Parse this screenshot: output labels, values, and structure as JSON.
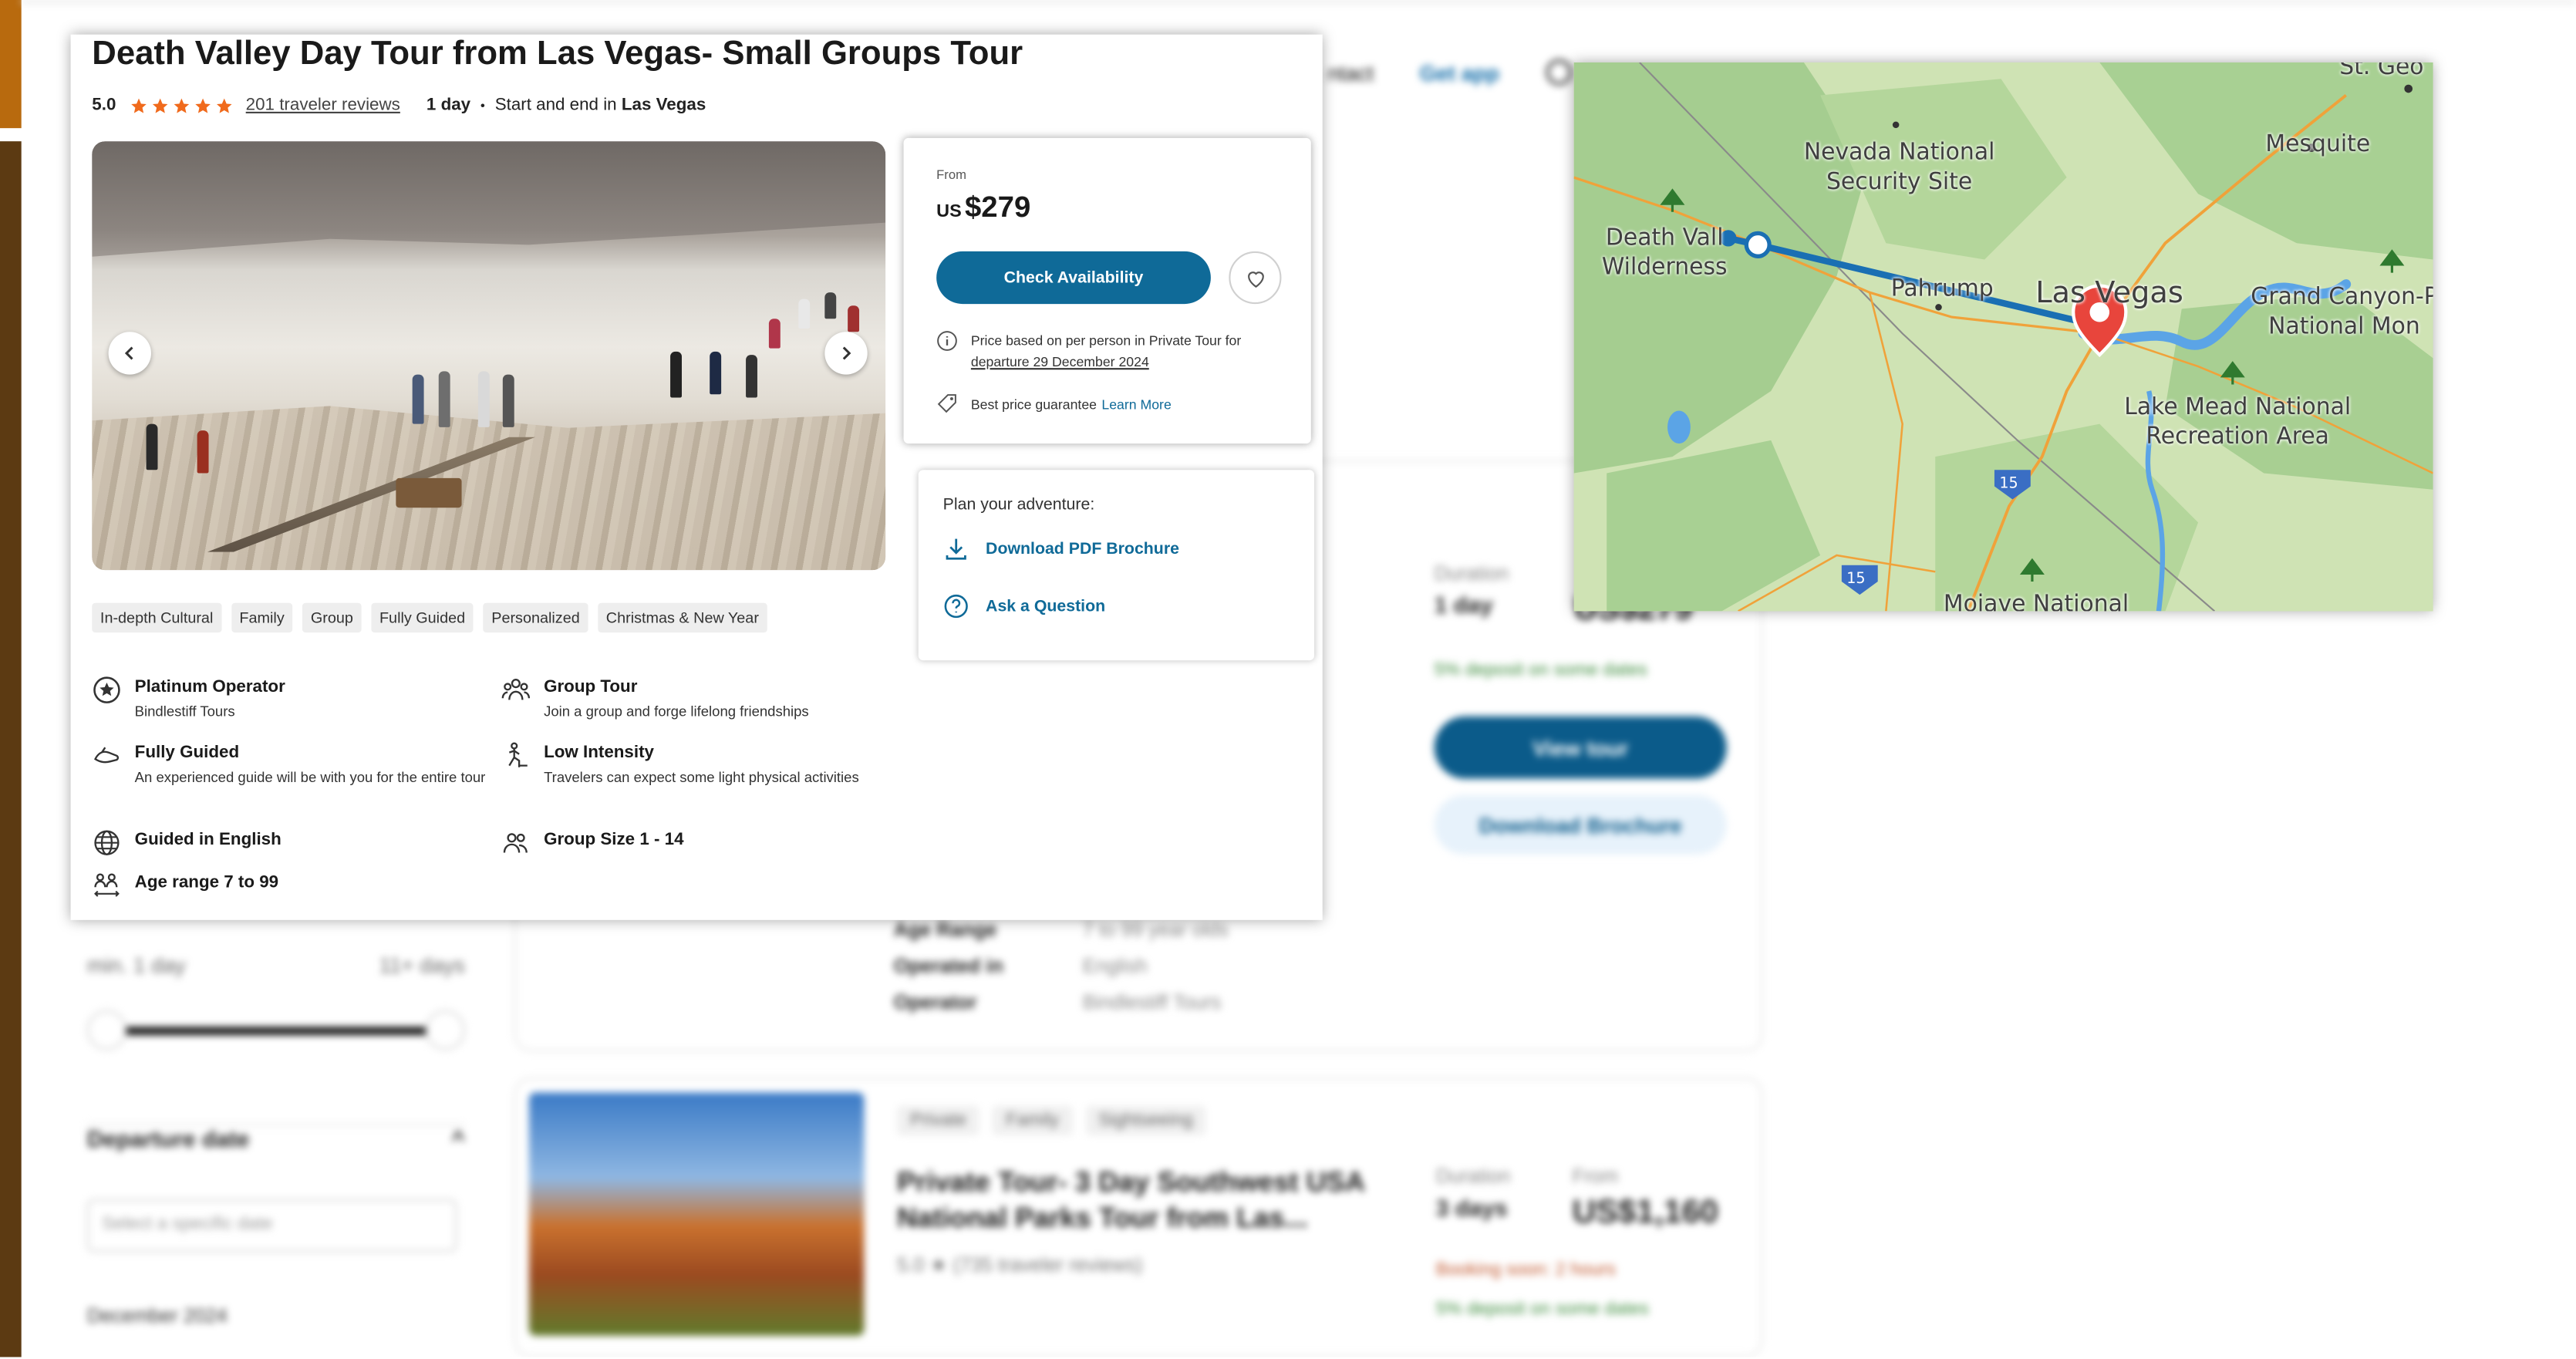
{
  "background": {
    "nav": {
      "contact": "ntact",
      "get_app": "Get app"
    },
    "card_labels": {
      "age_range": "Age Range",
      "operated_in": "Operated in",
      "operator": "Operator",
      "age_value": "7 to 99 year olds",
      "operated_value": "English",
      "operator_value": "Bindlestiff Tours"
    },
    "duration_label": "Duration",
    "duration_value": "1 day",
    "price_value": "US$279",
    "deposit_text": "5% deposit on some dates",
    "view_tour": "View tour",
    "download_brochure": "Download Brochure",
    "filter": {
      "min_label": "min. 1 day",
      "max_label": "11+ days",
      "departure_label": "Departure date",
      "date_placeholder": "Select a specific date",
      "month": "December 2024"
    },
    "card2": {
      "tags": [
        "Private",
        "Family",
        "Sightseeing"
      ],
      "title": "Private Tour- 3 Day Southwest USA National Parks Tour from Las...",
      "rating": "5.0 ★ (735 traveler reviews)",
      "duration_label": "Duration",
      "duration_value": "3 days",
      "price_label": "From",
      "price_value": "US$1,160",
      "booking": "Booking soon: 2 hours",
      "deposit": "5% deposit on some dates"
    }
  },
  "tour": {
    "title": "Death Valley Day Tour from Las Vegas- Small Groups Tour",
    "rating": "5.0",
    "stars": 5,
    "reviews": "201 traveler reviews",
    "duration": "1 day",
    "bullet": "•",
    "start_end_prefix": "Start and end in",
    "start_end_city": "Las Vegas",
    "tags": [
      "In-depth Cultural",
      "Family",
      "Group",
      "Fully Guided",
      "Personalized",
      "Christmas & New Year"
    ],
    "features": [
      {
        "icon": "star-badge-icon",
        "title": "Platinum Operator",
        "sub": "Bindlestiff Tours"
      },
      {
        "icon": "group-icon",
        "title": "Group Tour",
        "sub": "Join a group and forge lifelong friendships"
      },
      {
        "icon": "guide-icon",
        "title": "Fully Guided",
        "sub": "An experienced guide will be with you for the entire tour"
      },
      {
        "icon": "activity-icon",
        "title": "Low Intensity",
        "sub": "Travelers can expect some light physical activities"
      },
      {
        "icon": "globe-icon",
        "title": "Guided in English",
        "sub": ""
      },
      {
        "icon": "people-icon",
        "title": "Group Size 1 - 14",
        "sub": ""
      },
      {
        "icon": "age-icon",
        "title": "Age range 7 to 99",
        "sub": ""
      }
    ]
  },
  "booking": {
    "from_label": "From",
    "currency": "US",
    "price": "$279",
    "check_label": "Check Availability",
    "note_line1": "Price based on per person in Private Tour for",
    "note_line2": "departure 29 December 2024",
    "best_price": "Best price guarantee",
    "learn_more": "Learn More"
  },
  "plan": {
    "heading": "Plan your adventure:",
    "download_pdf": "Download PDF Brochure",
    "ask_question": "Ask a Question"
  },
  "map": {
    "labels": {
      "st_george": "St. Geo",
      "nevada_line1": "Nevada National",
      "nevada_line2": "Security Site",
      "mesquite": "Mesquite",
      "death_valley_line1": "Death Vall",
      "death_valley_line2": "Wilderness",
      "pahrump": "Pahrump",
      "las_vegas": "Las Vegas",
      "grand_canyon_line1": "Grand Canyon-P",
      "grand_canyon_line2": "National Mon",
      "lake_mead_line1": "Lake Mead National",
      "lake_mead_line2": "Recreation Area",
      "mojave": "Mojave National",
      "i15": "15"
    },
    "colors": {
      "route": "#1a6fb3",
      "pin": "#e8453c",
      "land": "#cfe3b4",
      "parks": "#9dc98a",
      "water": "#5ba4e6",
      "road": "#f0a23a"
    }
  }
}
